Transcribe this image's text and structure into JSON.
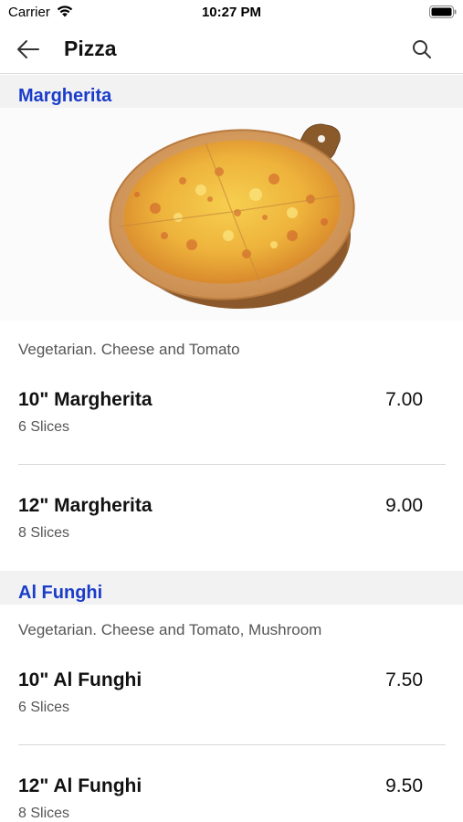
{
  "status_bar": {
    "carrier": "Carrier",
    "time": "10:27 PM"
  },
  "nav": {
    "title": "Pizza",
    "back_icon": "arrow-left-icon",
    "search_icon": "search-icon"
  },
  "sections": [
    {
      "name": "Margherita",
      "description": "Vegetarian. Cheese and Tomato",
      "image": "pizza-on-wooden-board",
      "items": [
        {
          "name": "10\" Margherita",
          "subtitle": "6 Slices",
          "price": "7.00"
        },
        {
          "name": "12\" Margherita",
          "subtitle": "8 Slices",
          "price": "9.00"
        }
      ]
    },
    {
      "name": "Al Funghi",
      "description": "Vegetarian. Cheese and Tomato, Mushroom",
      "items": [
        {
          "name": "10\" Al Funghi",
          "subtitle": "6 Slices",
          "price": "7.50"
        },
        {
          "name": "12\" Al Funghi",
          "subtitle": "8 Slices",
          "price": "9.50"
        }
      ]
    }
  ],
  "colors": {
    "section_title": "#1a3cc9",
    "section_background": "#f2f2f3",
    "divider": "#d9d9d9"
  }
}
